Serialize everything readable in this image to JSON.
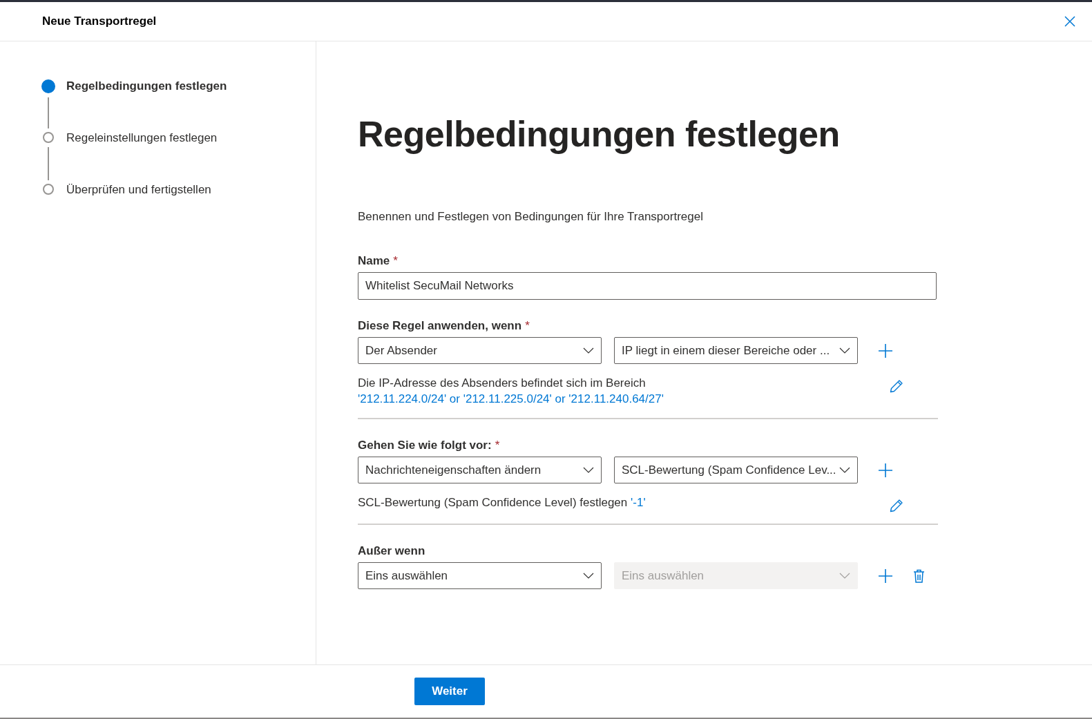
{
  "window": {
    "title": "Neue Transportregel"
  },
  "steps": [
    {
      "label": "Regelbedingungen festlegen",
      "selected": true
    },
    {
      "label": "Regeleinstellungen festlegen",
      "selected": false
    },
    {
      "label": "Überprüfen und fertigstellen",
      "selected": false
    }
  ],
  "page": {
    "heading": "Regelbedingungen festlegen",
    "intro": "Benennen und Festlegen von Bedingungen für Ihre Transportregel"
  },
  "name_field": {
    "label": "Name",
    "required_mark": "*",
    "value": "Whitelist SecuMail Networks"
  },
  "sections": [
    {
      "label": "Diese Regel anwenden, wenn",
      "required_mark": "*",
      "dropdowns": [
        {
          "value": "Der Absender",
          "disabled": false
        },
        {
          "value": "IP liegt in einem dieser Bereiche oder ...",
          "disabled": false
        }
      ],
      "actions": [
        {
          "kind": "add"
        }
      ],
      "description": {
        "text": "Die IP-Adresse des Absenders befindet sich im Bereich",
        "value": "'212.11.224.0/24' or '212.11.225.0/24' or '212.11.240.64/27'",
        "value_on_new_line": true
      }
    },
    {
      "label": "Gehen Sie wie folgt vor:",
      "required_mark": "*",
      "dropdowns": [
        {
          "value": "Nachrichteneigenschaften ändern",
          "disabled": false
        },
        {
          "value": "SCL-Bewertung (Spam Confidence Lev...",
          "disabled": false
        }
      ],
      "actions": [
        {
          "kind": "add"
        }
      ],
      "description": {
        "text": "SCL-Bewertung (Spam Confidence Level) festlegen",
        "value": "'-1'",
        "value_on_new_line": false
      }
    },
    {
      "label": "Außer wenn",
      "dropdowns": [
        {
          "value": "Eins auswählen",
          "disabled": false
        },
        {
          "value": "Eins auswählen",
          "disabled": true
        }
      ],
      "actions": [
        {
          "kind": "add"
        },
        {
          "kind": "delete"
        }
      ]
    }
  ],
  "footer": {
    "button": "Weiter"
  }
}
